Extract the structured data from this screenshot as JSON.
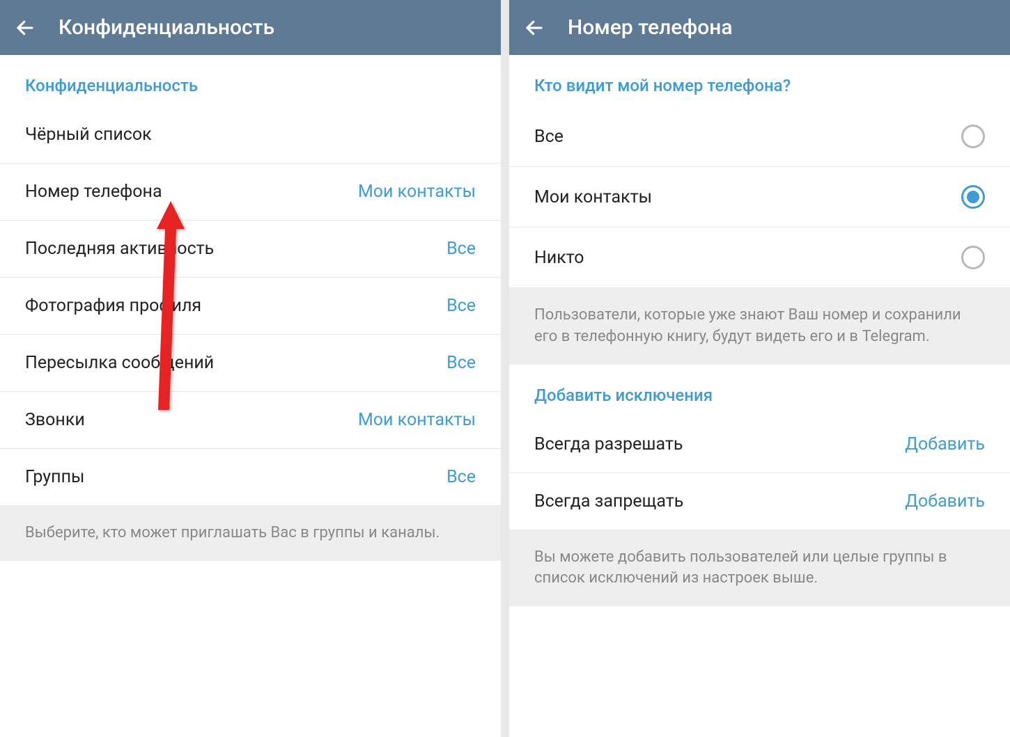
{
  "left": {
    "title": "Конфиденциальность",
    "section_header": "Конфиденциальность",
    "rows": [
      {
        "label": "Чёрный список",
        "value": ""
      },
      {
        "label": "Номер телефона",
        "value": "Мои контакты"
      },
      {
        "label": "Последняя активность",
        "value": "Все"
      },
      {
        "label": "Фотография профиля",
        "value": "Все"
      },
      {
        "label": "Пересылка сообщений",
        "value": "Все"
      },
      {
        "label": "Звонки",
        "value": "Мои контакты"
      },
      {
        "label": "Группы",
        "value": "Все"
      }
    ],
    "info": "Выберите, кто может приглашать Вас в группы и каналы."
  },
  "right": {
    "title": "Номер телефона",
    "section_header": "Кто видит мой номер телефона?",
    "options": [
      {
        "label": "Все",
        "selected": false
      },
      {
        "label": "Мои контакты",
        "selected": true
      },
      {
        "label": "Никто",
        "selected": false
      }
    ],
    "info1": "Пользователи, которые уже знают Ваш номер и сохранили его в телефонную книгу, будут видеть его и в Telegram.",
    "exceptions_header": "Добавить исключения",
    "exceptions": [
      {
        "label": "Всегда разрешать",
        "action": "Добавить"
      },
      {
        "label": "Всегда запрещать",
        "action": "Добавить"
      }
    ],
    "info2": "Вы можете добавить пользователей или целые группы в список исключений из настроек выше."
  }
}
